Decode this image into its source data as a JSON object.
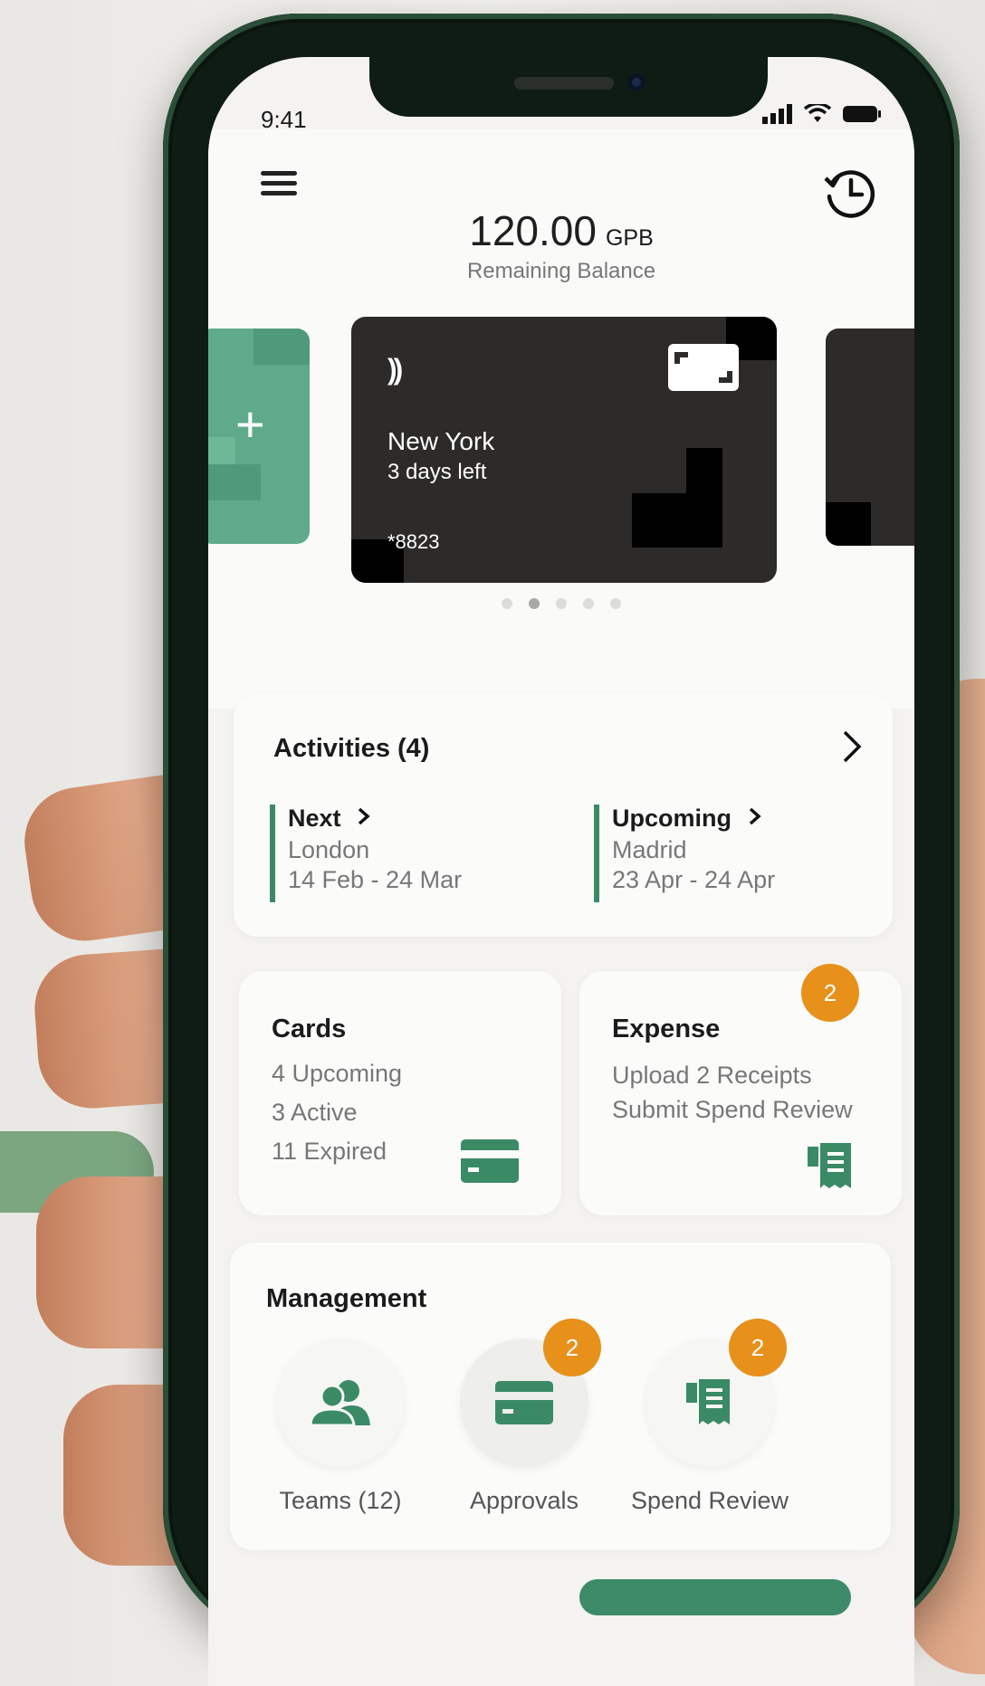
{
  "status": {
    "time": "9:41"
  },
  "header": {
    "balance_amount": "120.00",
    "balance_currency": "GPB",
    "balance_label": "Remaining Balance"
  },
  "card": {
    "city": "New York",
    "days_left": "3 days left",
    "number": "*8823",
    "contactless": "))"
  },
  "add_card": {
    "symbol": "+"
  },
  "carousel": {
    "page_count": 5,
    "active_index": 1
  },
  "activities": {
    "title": "Activities (4)",
    "next": {
      "label": "Next",
      "city": "London",
      "dates": "14 Feb - 24 Mar"
    },
    "upcoming": {
      "label": "Upcoming",
      "city": "Madrid",
      "dates": "23 Apr - 24 Apr"
    }
  },
  "cards_summary": {
    "title": "Cards",
    "upcoming": "4 Upcoming",
    "active": "3 Active",
    "expired": "11 Expired"
  },
  "expense": {
    "title": "Expense",
    "badge": "2",
    "line1": "Upload 2 Receipts",
    "line2": "Submit Spend Review"
  },
  "management": {
    "title": "Management",
    "teams": {
      "label": "Teams (12)"
    },
    "approvals": {
      "label": "Approvals",
      "badge": "2"
    },
    "spend_review": {
      "label": "Spend Review",
      "badge": "2"
    }
  },
  "colors": {
    "accent": "#3b8a66",
    "badge": "#e7901a",
    "card_dark": "#2d2b29",
    "add_card": "#5eaa8a"
  },
  "icons": [
    "menu-icon",
    "history-icon",
    "signal-icon",
    "wifi-icon",
    "battery-icon",
    "contactless-icon",
    "card-chip-icon",
    "plus-icon",
    "chevron-right-icon",
    "credit-card-icon",
    "receipt-icon",
    "team-icon"
  ]
}
